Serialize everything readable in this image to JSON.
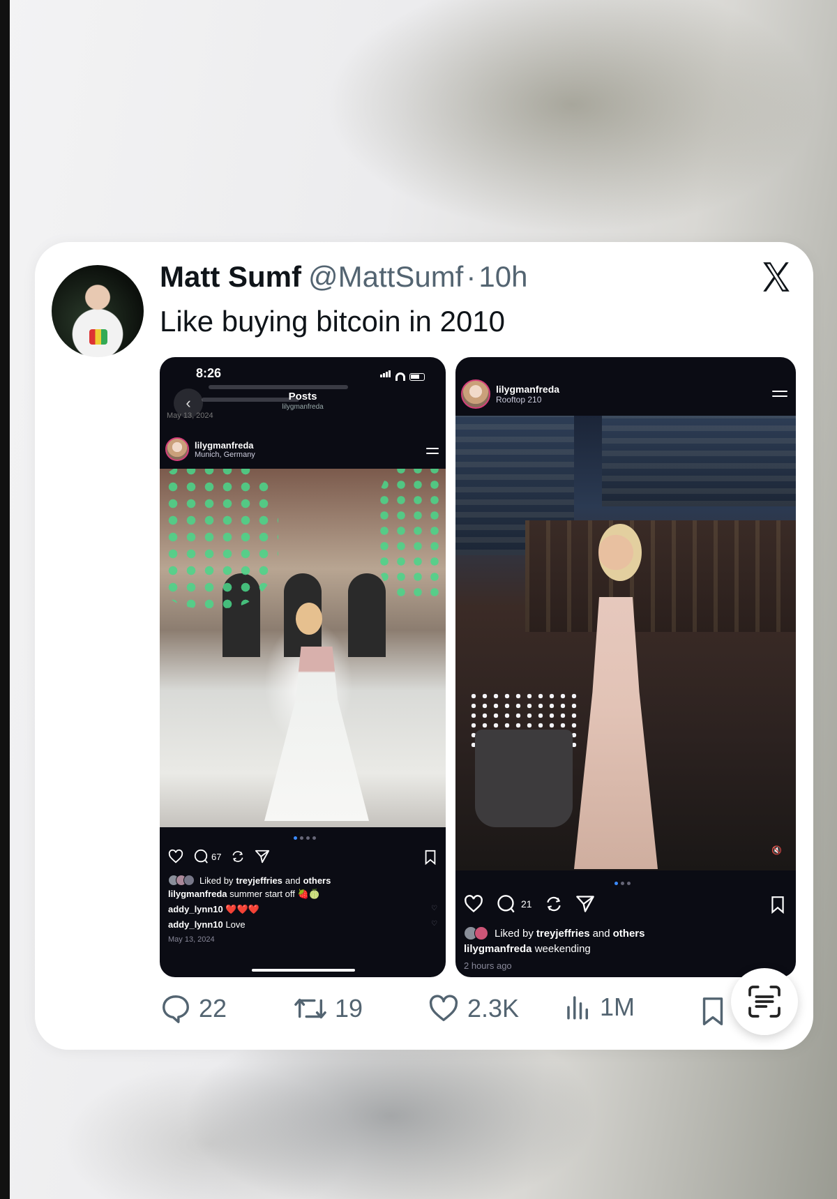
{
  "tweet": {
    "author_name": "Matt Sumf",
    "author_handle": "@MattSumf",
    "separator": "·",
    "time_ago": "10h",
    "text": "Like buying bitcoin in 2010"
  },
  "left_screenshot": {
    "status_time": "8:26",
    "header_title": "Posts",
    "header_subtitle": "lilygmanfreda",
    "faint_date": "May 13, 2024",
    "post_user": "lilygmanfreda",
    "post_location": "Munich, Germany",
    "comment_count": "67",
    "liked_prefix": "Liked by",
    "liked_user": "treyjeffries",
    "liked_and": "and",
    "liked_others": "others",
    "caption_user": "lilygmanfreda",
    "caption_text": "summer start off 🍓🍈",
    "comments": [
      {
        "user": "addy_lynn10",
        "text": "❤️❤️❤️"
      },
      {
        "user": "addy_lynn10",
        "text": "Love"
      }
    ],
    "date": "May 13, 2024"
  },
  "right_screenshot": {
    "post_user": "lilygmanfreda",
    "post_location": "Rooftop 210",
    "comment_count": "21",
    "liked_prefix": "Liked by",
    "liked_user": "treyjeffries",
    "liked_and": "and",
    "liked_others": "others",
    "caption_user": "lilygmanfreda",
    "caption_text": "weekending",
    "time_ago": "2 hours ago"
  },
  "engagement": {
    "replies": "22",
    "reposts": "19",
    "likes": "2.3K",
    "views": "1M"
  },
  "colors": {
    "text_primary": "#0f1419",
    "text_secondary": "#536471",
    "ig_ring": "#d63f7a",
    "dot_active": "#3c8bff"
  },
  "icons": [
    "x-logo-icon",
    "reply-icon",
    "repost-icon",
    "like-icon",
    "views-icon",
    "bookmark-icon",
    "scan-text-icon",
    "heart-icon",
    "comment-icon",
    "share-icon",
    "back-chevron-icon",
    "menu-icon",
    "mute-icon"
  ]
}
